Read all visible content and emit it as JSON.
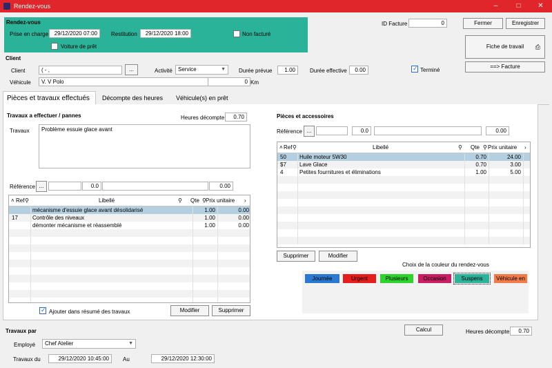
{
  "window": {
    "title": "Rendez-vous",
    "app_icon": "wd-icon",
    "accent": "#e0262a"
  },
  "rdv": {
    "section_title": "Rendez-vous",
    "prise_label": "Prise en charge",
    "prise_value": "29/12/2020 07:00",
    "restitution_label": "Restitution",
    "restitution_value": "29/12/2020 18:00",
    "voiture_label": "Voiture de prêt",
    "voiture_checked": false,
    "non_facture_label": "Non facturé",
    "non_facture_checked": false,
    "panel_color": "#2bb39a"
  },
  "facture": {
    "id_label": "ID Facture",
    "id_value": "0",
    "fermer_label": "Fermer",
    "enregistrer_label": "Enregistrer",
    "fiche_label": "Fiche de travail",
    "facture_btn_label": "==> Facture"
  },
  "client": {
    "section_title": "Client",
    "client_label": "Client",
    "client_value": "(           -           ,",
    "dots_label": "...",
    "activite_label": "Activité",
    "activite_value": "Service",
    "duree_prevue_label": "Durée prévue",
    "duree_prevue_value": "1.00",
    "duree_effective_label": "Durée effective",
    "duree_effective_value": "0.00",
    "termine_label": "Terminé",
    "termine_checked": true,
    "vehicule_label": "Véhicule",
    "vehicule_value": "V.                   V Polo",
    "km_label": "Km",
    "km_value": "0"
  },
  "tabs": [
    {
      "label": "Pièces et travaux effectués",
      "active": true
    },
    {
      "label": "Décompte des heures",
      "active": false
    },
    {
      "label": "Véhicule(s) en prêt",
      "active": false
    }
  ],
  "travaux": {
    "section_title": "Travaux a effectuer / pannes",
    "heures_label": "Heures décompte",
    "heures_value": "0.70",
    "travaux_label": "Travaux",
    "travaux_text": "Problème essuie glace avant",
    "reference_label": "Référence",
    "dots_label": "...",
    "ref_qty": "0.0",
    "ref_price": "0.00",
    "columns": [
      "Ref",
      "Libellé",
      "Qte",
      "Prix unitaire"
    ],
    "rows": [
      {
        "ref": "",
        "libelle": "mécanisme d'essuie glace avant désolidarisé",
        "qte": "1.00",
        "prix": "0.00"
      },
      {
        "ref": "17",
        "libelle": "Contrôle des niveaux",
        "qte": "1.00",
        "prix": "0.00"
      },
      {
        "ref": "",
        "libelle": "démonter mécanisme et réassemblé",
        "qte": "1.00",
        "prix": "0.00"
      }
    ],
    "ajouter_label": "Ajouter dans résumé des travaux",
    "ajouter_checked": true,
    "modifier_label": "Modifier",
    "supprimer_label": "Supprimer"
  },
  "pieces": {
    "section_title": "Pièces et accessoires",
    "reference_label": "Référence",
    "dots_label": "...",
    "ref_qty": "0.0",
    "ref_price": "0.00",
    "columns": [
      "Ref",
      "Libellé",
      "Qte",
      "Prix unitaire"
    ],
    "rows": [
      {
        "ref": "50",
        "libelle": "Huile moteur 5W30",
        "qte": "0.70",
        "prix": "24.00"
      },
      {
        "ref": "$7",
        "libelle": "Lave Glace",
        "qte": "0.70",
        "prix": "3.00"
      },
      {
        "ref": "4",
        "libelle": "Petites fournitures et éliminations",
        "qte": "1.00",
        "prix": "5.00"
      }
    ],
    "supprimer_label": "Supprimer",
    "modifier_label": "Modifier"
  },
  "couleurs": {
    "title": "Choix de la couleur du rendez-vous",
    "items": [
      {
        "label": "Journée",
        "color": "#2a78d0",
        "text": "#000000"
      },
      {
        "label": "Urgent",
        "color": "#e61d1d",
        "text": "#000000"
      },
      {
        "label": "Plusieurs",
        "color": "#2cd42c",
        "text": "#000000"
      },
      {
        "label": "Occasion",
        "color": "#c81e64",
        "text": "#000000"
      },
      {
        "label": "Suspens",
        "color": "#2bb39a",
        "text": "#000000"
      },
      {
        "label": "Véhicule en",
        "color": "#f07c4a",
        "text": "#000000"
      }
    ]
  },
  "travaux_par": {
    "section_title": "Travaux par",
    "employe_label": "Employé",
    "employe_value": "Chef Atelier",
    "du_label": "Travaux du",
    "du_value": "29/12/2020 10:45:00",
    "au_label": "Au",
    "au_value": "29/12/2020 12:30:00",
    "calcul_label": "Calcul",
    "heures_label": "Heures décompte",
    "heures_value": "0.70"
  }
}
